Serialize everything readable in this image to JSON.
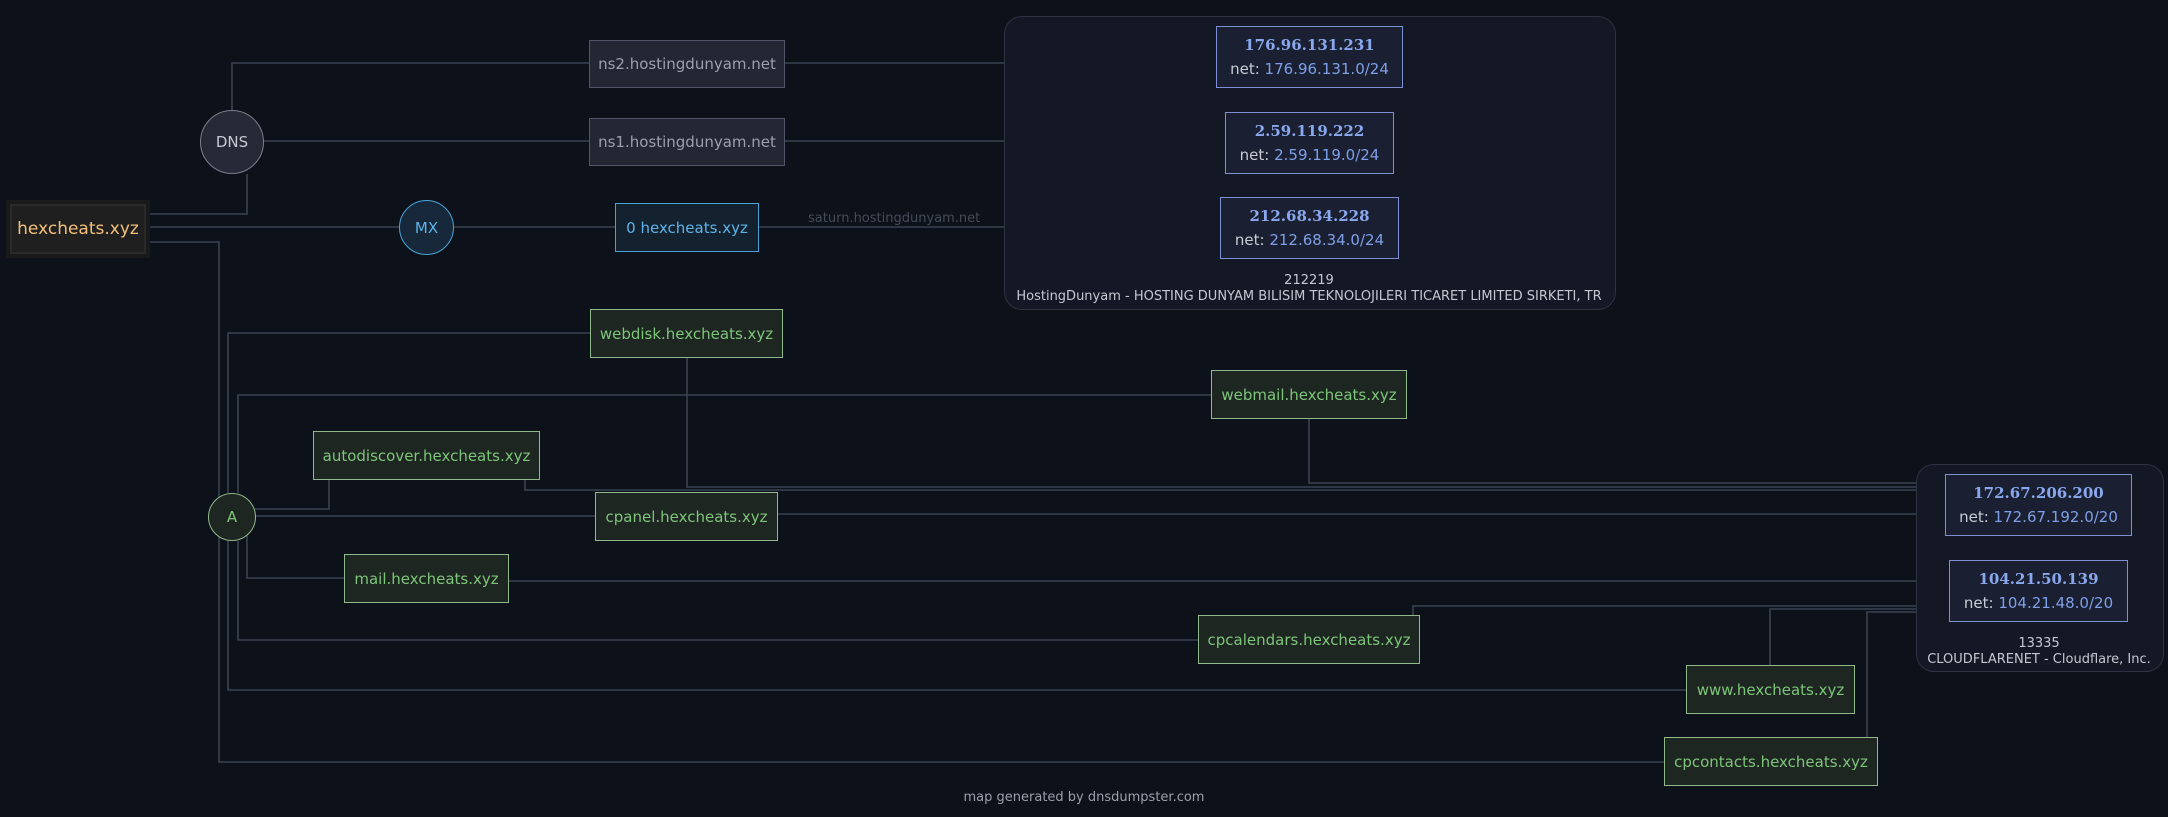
{
  "root": "hexcheats.xyz",
  "types": {
    "dns": "DNS",
    "mx": "MX",
    "a": "A"
  },
  "nameservers": [
    "ns2.hostingdunyam.net",
    "ns1.hostingdunyam.net"
  ],
  "mx_record": "0 hexcheats.xyz",
  "mx_edge_label": "saturn.hostingdunyam.net",
  "net_prefix": "net: ",
  "asn_groups": [
    {
      "asn": "212219",
      "name": "HostingDunyam - HOSTING DUNYAM BILISIM TEKNOLOJILERI TICARET LIMITED SIRKETI, TR"
    },
    {
      "asn": "13335",
      "name": "CLOUDFLARENET - Cloudflare, Inc."
    }
  ],
  "ips": [
    {
      "ip": "176.96.131.231",
      "net": "176.96.131.0/24"
    },
    {
      "ip": "2.59.119.222",
      "net": "2.59.119.0/24"
    },
    {
      "ip": "212.68.34.228",
      "net": "212.68.34.0/24"
    },
    {
      "ip": "172.67.206.200",
      "net": "172.67.192.0/20"
    },
    {
      "ip": "104.21.50.139",
      "net": "104.21.48.0/20"
    }
  ],
  "hosts": {
    "webdisk": "webdisk.hexcheats.xyz",
    "webmail": "webmail.hexcheats.xyz",
    "autodiscover": "autodiscover.hexcheats.xyz",
    "cpanel": "cpanel.hexcheats.xyz",
    "mail": "mail.hexcheats.xyz",
    "cpcalendars": "cpcalendars.hexcheats.xyz",
    "www": "www.hexcheats.xyz",
    "cpcontacts": "cpcontacts.hexcheats.xyz"
  },
  "colors": {
    "background": "#0d1119",
    "root_text": "#f5c07a",
    "host_text": "#7dc57a",
    "mx_text": "#5db4ea",
    "ip_text": "#8aa8ee",
    "wire": "#3a4252"
  },
  "footer": "map generated by dnsdumpster.com"
}
